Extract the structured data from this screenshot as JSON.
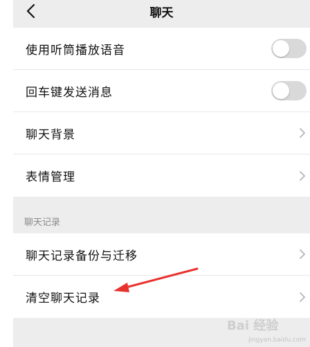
{
  "header": {
    "title": "聊天",
    "back_icon": "chevron-left-icon"
  },
  "settings": {
    "rows": [
      {
        "label": "使用听筒播放语音",
        "control": "toggle",
        "on": false
      },
      {
        "label": "回车键发送消息",
        "control": "toggle",
        "on": false
      },
      {
        "label": "聊天背景",
        "control": "chevron"
      },
      {
        "label": "表情管理",
        "control": "chevron"
      }
    ]
  },
  "history_section": {
    "title": "聊天记录",
    "rows": [
      {
        "label": "聊天记录备份与迁移",
        "control": "chevron"
      },
      {
        "label": "清空聊天记录",
        "control": "chevron"
      }
    ]
  },
  "annotation": {
    "arrow_color": "#e8322e"
  },
  "watermark": {
    "text": "Bai 经验",
    "sub": "jingyan.baidu.com"
  },
  "colors": {
    "background": "#ededed",
    "cell": "#ffffff",
    "toggle_off": "#d9d9d9",
    "chevron": "#b5b5b5"
  }
}
